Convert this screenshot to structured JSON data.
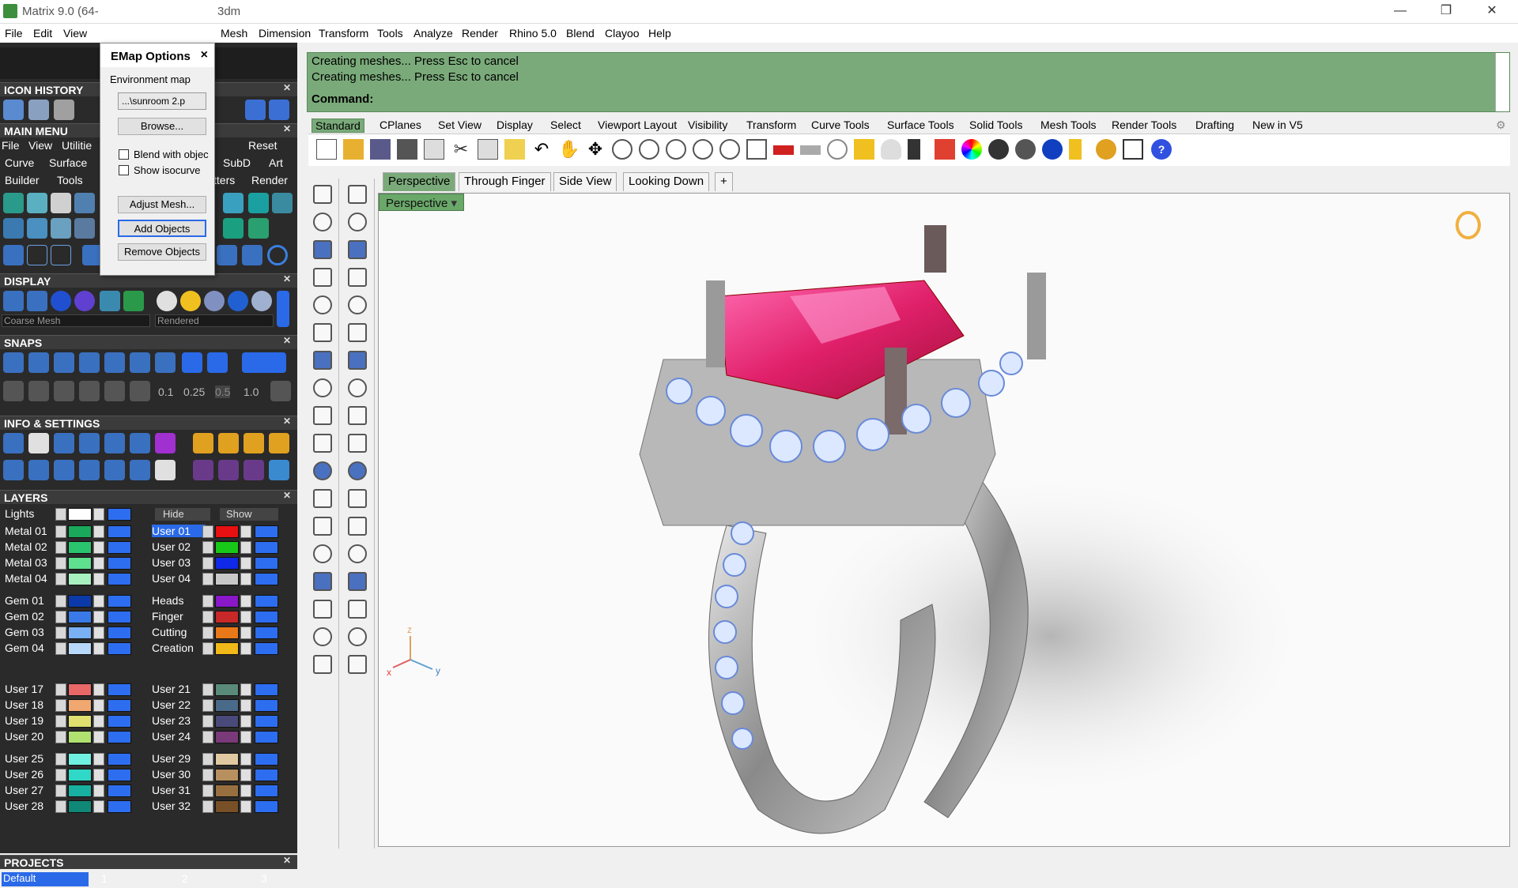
{
  "window": {
    "title_left": "Matrix 9.0 (64-",
    "title_right": "3dm",
    "minimize": "—",
    "restore": "❐",
    "close": "✕"
  },
  "menubar": {
    "items": [
      "File",
      "Edit",
      "View",
      "Mesh",
      "Dimension",
      "Transform",
      "Tools",
      "Analyze",
      "Render",
      "Rhino 5.0",
      "Blend",
      "Clayoo",
      "Help"
    ]
  },
  "emap": {
    "title": "EMap Options",
    "close": "×",
    "env_label": "Environment map",
    "select_value": "...\\sunroom 2.p",
    "browse": "Browse...",
    "blend": "Blend with objec",
    "isocurve": "Show isocurve",
    "adjust": "Adjust Mesh...",
    "add": "Add Objects",
    "remove": "Remove Objects"
  },
  "sections": {
    "icon_history": "ICON HISTORY",
    "main_menu": "MAIN MENU",
    "display": "DISPLAY",
    "snaps": "SNAPS",
    "info": "INFO & SETTINGS",
    "layers": "LAYERS",
    "projects": "PROJECTS"
  },
  "mainmenu": {
    "file": "File",
    "view": "View",
    "utilities": "Utilitie",
    "reset": "Reset",
    "curve": "Curve",
    "surface": "Surface",
    "subd": "SubD",
    "art": "Art",
    "builder": "Builder",
    "tools": "Tools",
    "atters": "tters",
    "render": "Render"
  },
  "display": {
    "mesh": "Coarse Mesh",
    "mode": "Rendered"
  },
  "snaps": {
    "values": [
      "0.1",
      "0.25",
      "0.5",
      "1.0"
    ]
  },
  "layers": {
    "lights": "Lights",
    "hide": "Hide",
    "show": "Show",
    "left": [
      "Metal 01",
      "Metal 02",
      "Metal 03",
      "Metal 04",
      "Gem 01",
      "Gem 02",
      "Gem 03",
      "Gem 04",
      "User 17",
      "User 18",
      "User 19",
      "User 20",
      "User 25",
      "User 26",
      "User 27",
      "User 28"
    ],
    "right": [
      "User 01",
      "User 02",
      "User 03",
      "User 04",
      "Heads",
      "Finger",
      "Cutting",
      "Creation",
      "User 21",
      "User 22",
      "User 23",
      "User 24",
      "User 29",
      "User 30",
      "User 31",
      "User 32"
    ],
    "left_colors": [
      "#1aa85a",
      "#2bc46e",
      "#5ee08e",
      "#a8f0c0",
      "#0b3aa8",
      "#3a7ae8",
      "#7ab0f4",
      "#b8d8fa",
      "#e86868",
      "#f0a870",
      "#e0e070",
      "#b0e070",
      "#70f0e0",
      "#30d8c8",
      "#18b0a0",
      "#108878"
    ],
    "right_colors": [
      "#e81010",
      "#18c818",
      "#1028e8",
      "#c8c8c8",
      "#8818c8",
      "#c82828",
      "#e87818",
      "#f0b818",
      "#5a8a7a",
      "#4a6a8a",
      "#4a4a7a",
      "#7a3a7a",
      "#e0c8a0",
      "#b89060",
      "#987040",
      "#785028"
    ]
  },
  "projects": {
    "name": "Default",
    "nums": [
      "1",
      "2",
      "3"
    ]
  },
  "cmd": {
    "line1": "Creating meshes... Press Esc to cancel",
    "line2": "Creating meshes... Press Esc to cancel",
    "label": "Command:"
  },
  "tabs": [
    "Standard",
    "CPlanes",
    "Set View",
    "Display",
    "Select",
    "Viewport Layout",
    "Visibility",
    "Transform",
    "Curve Tools",
    "Surface Tools",
    "Solid Tools",
    "Mesh Tools",
    "Render Tools",
    "Drafting",
    "New in V5"
  ],
  "viewport_tabs": [
    "Perspective",
    "Through Finger",
    "Side View",
    "Looking Down",
    "+"
  ],
  "viewport": {
    "label": "Perspective",
    "axis_x": "x",
    "axis_y": "y",
    "axis_z": "z"
  }
}
